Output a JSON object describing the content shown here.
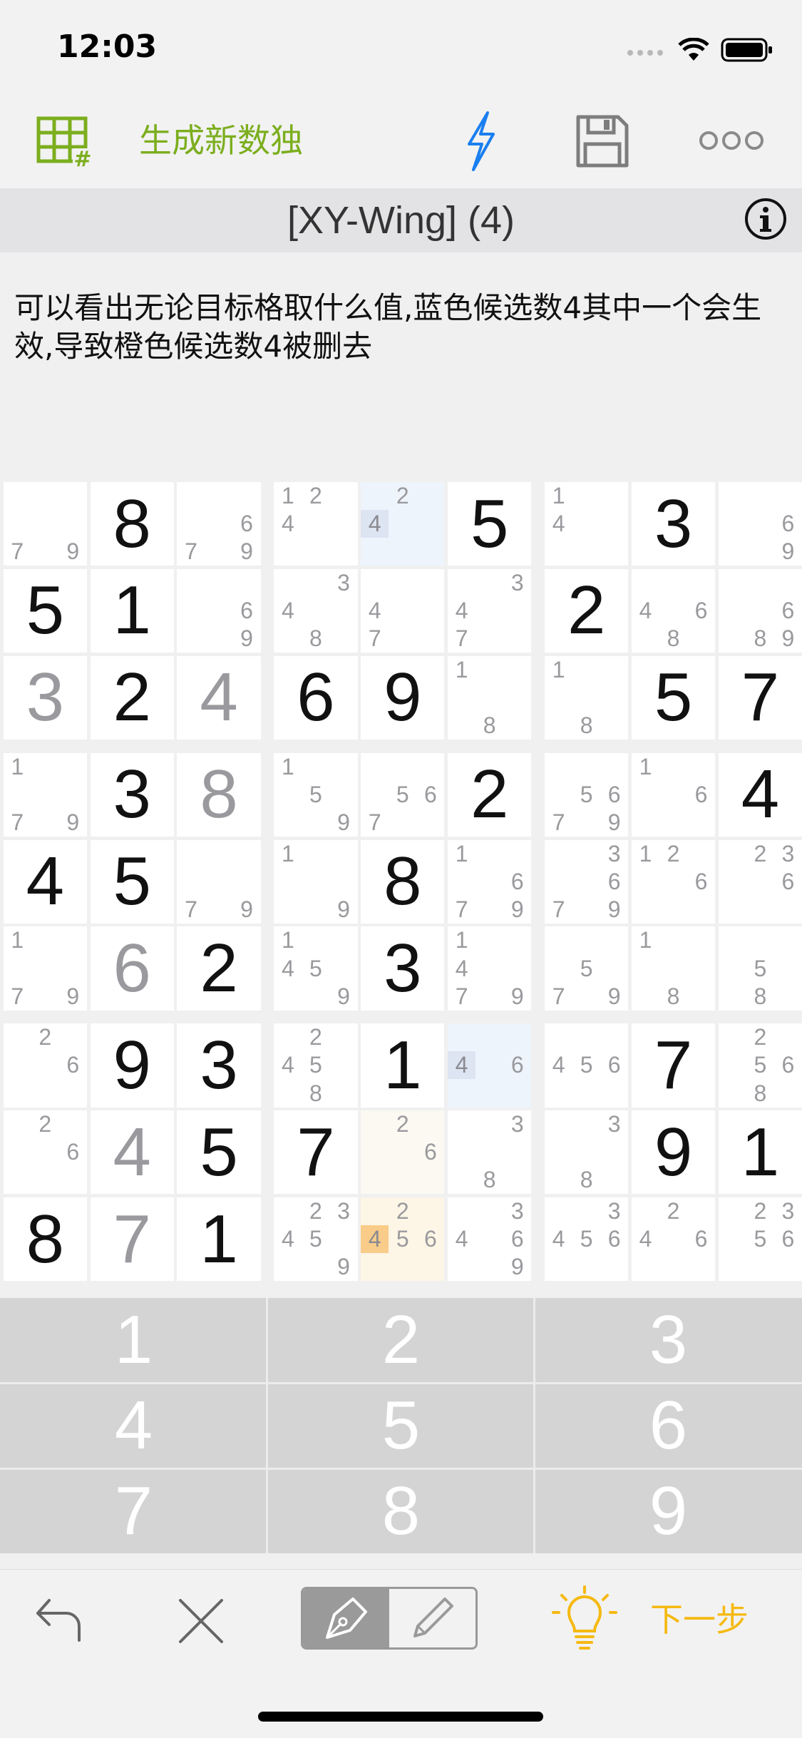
{
  "status_bar": {
    "time": "12:03"
  },
  "toolbar": {
    "new_sudoku_label": "生成新数独",
    "accent_color": "#7cae1e",
    "lightning_color": "#1a7ff0"
  },
  "hint": {
    "title": "[XY-Wing] (4)",
    "description": "可以看出无论目标格取什么值,蓝色候选数4其中一个会生效,导致橙色候选数4被删去"
  },
  "board": {
    "rows": [
      [
        {
          "c": "79"
        },
        {
          "v": "8",
          "t": "g"
        },
        {
          "c": "679"
        },
        {
          "c": "124"
        },
        {
          "c": "24",
          "hb": "4",
          "bg": "#eef4fc"
        },
        {
          "v": "5",
          "t": "g"
        },
        {
          "c": "14"
        },
        {
          "v": "3",
          "t": "g"
        },
        {
          "c": "69"
        }
      ],
      [
        {
          "v": "5",
          "t": "g"
        },
        {
          "v": "1",
          "t": "g"
        },
        {
          "c": "69"
        },
        {
          "c": "348"
        },
        {
          "c": "47"
        },
        {
          "c": "347"
        },
        {
          "v": "2",
          "t": "g"
        },
        {
          "c": "468"
        },
        {
          "c": "689"
        }
      ],
      [
        {
          "v": "3",
          "t": "u"
        },
        {
          "v": "2",
          "t": "g"
        },
        {
          "v": "4",
          "t": "u"
        },
        {
          "v": "6",
          "t": "g"
        },
        {
          "v": "9",
          "t": "g"
        },
        {
          "c": "18"
        },
        {
          "c": "18"
        },
        {
          "v": "5",
          "t": "g"
        },
        {
          "v": "7",
          "t": "g"
        }
      ],
      [
        {
          "c": "179"
        },
        {
          "v": "3",
          "t": "g"
        },
        {
          "v": "8",
          "t": "u"
        },
        {
          "c": "159"
        },
        {
          "c": "567"
        },
        {
          "v": "2",
          "t": "g"
        },
        {
          "c": "5679"
        },
        {
          "c": "16"
        },
        {
          "v": "4",
          "t": "g"
        }
      ],
      [
        {
          "v": "4",
          "t": "g"
        },
        {
          "v": "5",
          "t": "g"
        },
        {
          "c": "79"
        },
        {
          "c": "19"
        },
        {
          "v": "8",
          "t": "g"
        },
        {
          "c": "1679"
        },
        {
          "c": "3679"
        },
        {
          "c": "126"
        },
        {
          "c": "236"
        }
      ],
      [
        {
          "c": "179"
        },
        {
          "v": "6",
          "t": "u"
        },
        {
          "v": "2",
          "t": "g"
        },
        {
          "c": "1459"
        },
        {
          "v": "3",
          "t": "g"
        },
        {
          "c": "1479"
        },
        {
          "c": "579"
        },
        {
          "c": "18"
        },
        {
          "c": "58"
        }
      ],
      [
        {
          "c": "26"
        },
        {
          "v": "9",
          "t": "g"
        },
        {
          "v": "3",
          "t": "g"
        },
        {
          "c": "2458"
        },
        {
          "v": "1",
          "t": "g"
        },
        {
          "c": "46",
          "hb": "4",
          "bg": "#eef4fc"
        },
        {
          "c": "456"
        },
        {
          "v": "7",
          "t": "g"
        },
        {
          "c": "2568"
        }
      ],
      [
        {
          "c": "26"
        },
        {
          "v": "4",
          "t": "u"
        },
        {
          "v": "5",
          "t": "g"
        },
        {
          "v": "7",
          "t": "g"
        },
        {
          "c": "26",
          "bg": "#fbf9f1"
        },
        {
          "c": "38"
        },
        {
          "c": "38"
        },
        {
          "v": "9",
          "t": "g"
        },
        {
          "v": "1",
          "t": "g"
        }
      ],
      [
        {
          "v": "8",
          "t": "g"
        },
        {
          "v": "7",
          "t": "u"
        },
        {
          "v": "1",
          "t": "g"
        },
        {
          "c": "23459"
        },
        {
          "c": "2456",
          "ho": "4",
          "bg": "#fdf5e5"
        },
        {
          "c": "3469"
        },
        {
          "c": "3456"
        },
        {
          "c": "246"
        },
        {
          "c": "2356"
        }
      ]
    ]
  },
  "keypad": {
    "keys": [
      "1",
      "2",
      "3",
      "4",
      "5",
      "6",
      "7",
      "8",
      "9"
    ]
  },
  "bottom": {
    "next_label": "下一步",
    "next_color": "#f5b911"
  }
}
